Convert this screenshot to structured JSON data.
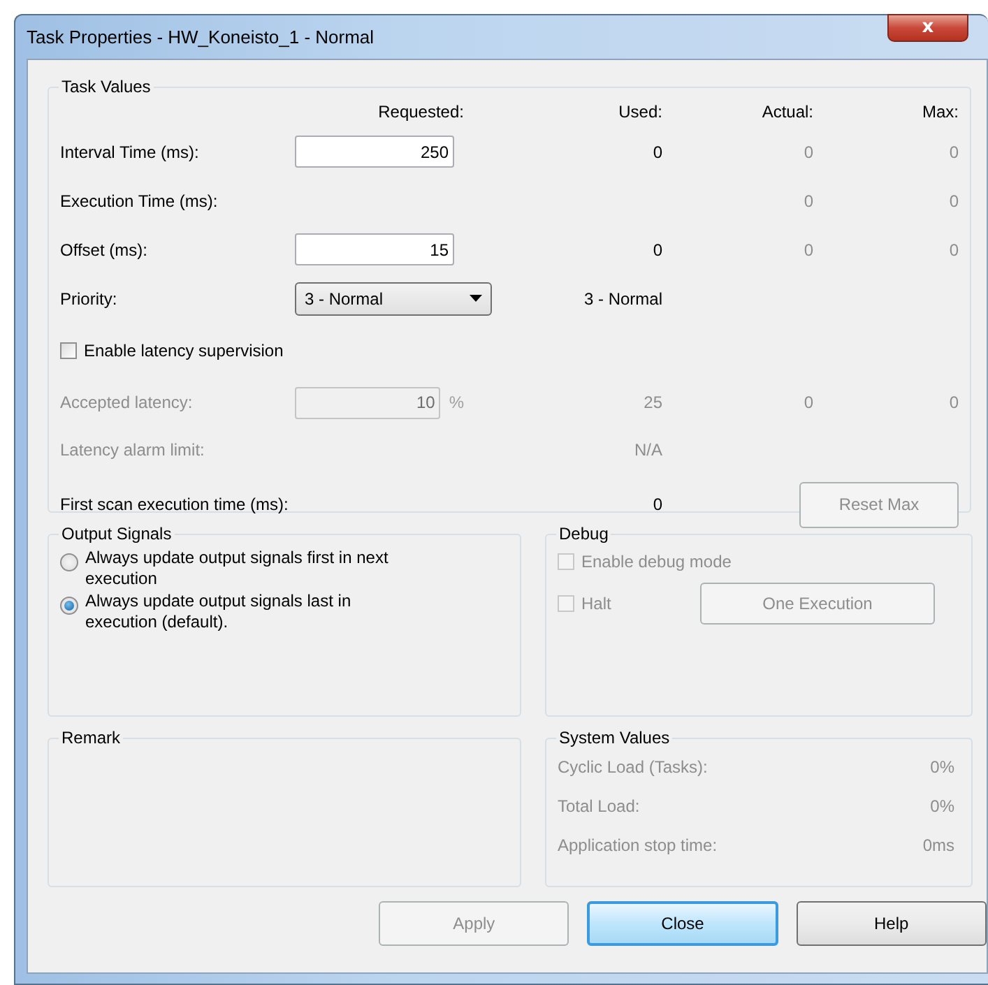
{
  "window": {
    "title": "Task Properties - HW_Koneisto_1 - Normal",
    "close": "x"
  },
  "task_values": {
    "title": "Task Values",
    "columns": [
      "Requested:",
      "Used:",
      "Actual:",
      "Max:"
    ],
    "rows": [
      {
        "kind": "input",
        "label": "Interval Time (ms):",
        "requested": "250",
        "used": "0",
        "actual": "0",
        "max": "0",
        "disabled": false
      },
      {
        "kind": "text",
        "label": "Execution Time (ms):",
        "actual": "0",
        "max": "0",
        "disabled": false
      },
      {
        "kind": "input",
        "label": "Offset (ms):",
        "requested": "15",
        "used": "0",
        "actual": "0",
        "max": "0",
        "disabled": false
      },
      {
        "kind": "select",
        "label": "Priority:",
        "requested": "3 - Normal",
        "used": "3 - Normal",
        "disabled": false
      },
      {
        "kind": "checkbox",
        "label": "Enable latency supervision",
        "checked": false,
        "disabled": false
      },
      {
        "kind": "input",
        "label": "Accepted latency:",
        "requested": "10",
        "unit": "%",
        "used": "25",
        "actual": "0",
        "max": "0",
        "disabled": true
      },
      {
        "kind": "text",
        "label": "Latency alarm limit:",
        "used": "N/A",
        "disabled": true
      },
      {
        "kind": "button",
        "label": "First scan execution time (ms):",
        "used": "0",
        "button": "Reset Max",
        "disabled": false,
        "button_disabled": true
      }
    ]
  },
  "output_signals": {
    "title": "Output Signals",
    "options": [
      {
        "label": "Always update output signals first in next execution",
        "selected": false
      },
      {
        "label": "Always update output signals last in execution (default).",
        "selected": true
      }
    ]
  },
  "debug": {
    "title": "Debug",
    "enable": {
      "label": "Enable debug mode",
      "checked": false,
      "disabled": true
    },
    "halt": {
      "label": "Halt",
      "checked": false,
      "disabled": true
    },
    "button": {
      "label": "One Execution",
      "disabled": true
    }
  },
  "remark": {
    "title": "Remark"
  },
  "system_values": {
    "title": "System Values",
    "rows": [
      {
        "label": "Cyclic Load (Tasks):",
        "value": "0%"
      },
      {
        "label": "Total Load:",
        "value": "0%"
      },
      {
        "label": "Application stop time:",
        "value": "0ms"
      }
    ]
  },
  "buttons": [
    {
      "label": "Apply",
      "disabled": true,
      "default": false
    },
    {
      "label": "Close",
      "disabled": false,
      "default": true
    },
    {
      "label": "Help",
      "disabled": false,
      "default": false
    }
  ]
}
